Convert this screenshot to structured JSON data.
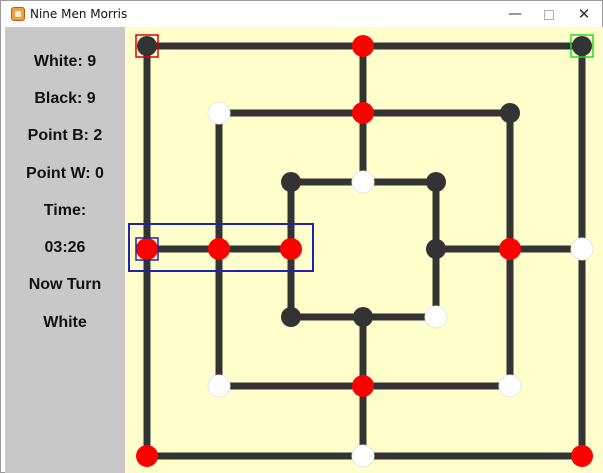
{
  "window": {
    "title": "Nine Men Morris",
    "app_icon": "board-game-icon",
    "controls": {
      "minimize": {
        "glyph": "—",
        "icon": "minimize-icon"
      },
      "maximize": {
        "glyph": "",
        "icon": "maximize-icon"
      },
      "close": {
        "glyph": "✕",
        "icon": "close-icon"
      }
    }
  },
  "sidebar": {
    "white_count": "White: 9",
    "black_count": "Black: 9",
    "point_b": "Point B: 2",
    "point_w": "Point W: 0",
    "time_label": "Time:",
    "time_value": "03:26",
    "turn_label": "Now Turn",
    "turn_value": "White"
  },
  "board": {
    "colors": {
      "background": "#ffffcc",
      "line": "#333333",
      "black_piece": "#333333",
      "white_piece": "#ffffff",
      "red_piece": "#ff0000",
      "highlight_red": "#dd0000",
      "highlight_green": "#22dd22",
      "highlight_blue": "#2222aa"
    },
    "pieces": [
      {
        "id": "a7",
        "color": "black",
        "highlight": "red"
      },
      {
        "id": "d7",
        "color": "red"
      },
      {
        "id": "g7",
        "color": "black",
        "highlight": "green"
      },
      {
        "id": "b6",
        "color": "white"
      },
      {
        "id": "d6",
        "color": "red"
      },
      {
        "id": "f6",
        "color": "black"
      },
      {
        "id": "c5",
        "color": "black"
      },
      {
        "id": "d5",
        "color": "white"
      },
      {
        "id": "e5",
        "color": "black"
      },
      {
        "id": "a4",
        "color": "red",
        "highlight": "blue"
      },
      {
        "id": "b4",
        "color": "red"
      },
      {
        "id": "c4",
        "color": "red"
      },
      {
        "id": "e4",
        "color": "black"
      },
      {
        "id": "f4",
        "color": "red"
      },
      {
        "id": "g4",
        "color": "white"
      },
      {
        "id": "c3",
        "color": "black"
      },
      {
        "id": "d3",
        "color": "black"
      },
      {
        "id": "e3",
        "color": "white"
      },
      {
        "id": "b2",
        "color": "white"
      },
      {
        "id": "d2",
        "color": "red"
      },
      {
        "id": "f2",
        "color": "white"
      },
      {
        "id": "a1",
        "color": "red"
      },
      {
        "id": "d1",
        "color": "white"
      },
      {
        "id": "g1",
        "color": "red"
      }
    ],
    "mill_highlight": [
      "a4",
      "b4",
      "c4"
    ]
  }
}
